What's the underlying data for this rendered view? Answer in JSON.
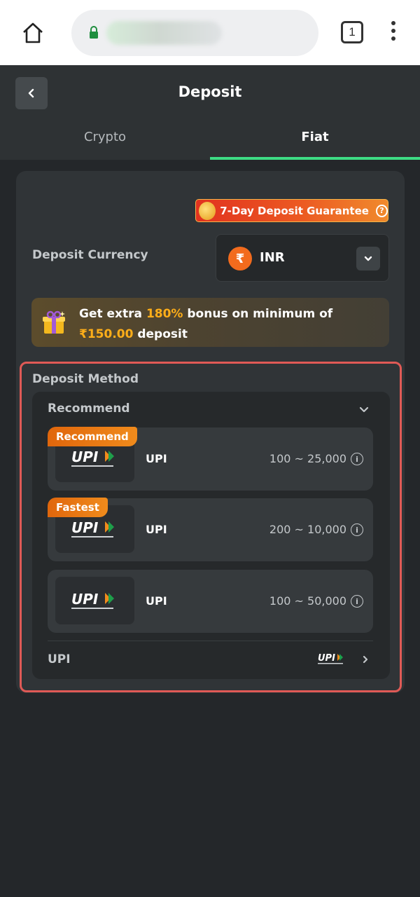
{
  "browser": {
    "tab_count": "1",
    "icons": [
      "home-icon",
      "lock-icon",
      "more-vert-icon"
    ]
  },
  "header": {
    "title": "Deposit",
    "tabs": [
      {
        "label": "Crypto",
        "active": false
      },
      {
        "label": "Fiat",
        "active": true
      }
    ],
    "accent_color": "#3ddc84"
  },
  "guarantee": {
    "label": "7-Day Deposit Guarantee",
    "help_glyph": "?"
  },
  "currency": {
    "label": "Deposit Currency",
    "symbol": "₹",
    "value": "INR"
  },
  "bonus": {
    "prefix": "Get extra ",
    "percent": "180%",
    "middle": " bonus on minimum of ",
    "amount": "₹150.00",
    "suffix": " deposit",
    "highlight_color": "#ffae19"
  },
  "deposit_method": {
    "title": "Deposit Method",
    "group_label": "Recommend",
    "methods": [
      {
        "badge": "Recommend",
        "name": "UPI",
        "range": "100 ~ 25,000"
      },
      {
        "badge": "Fastest",
        "name": "UPI",
        "range": "200 ~ 10,000"
      },
      {
        "badge": "",
        "name": "UPI",
        "range": "100 ~ 50,000"
      }
    ],
    "more_link": {
      "label": "UPI"
    },
    "info_glyph": "i"
  }
}
